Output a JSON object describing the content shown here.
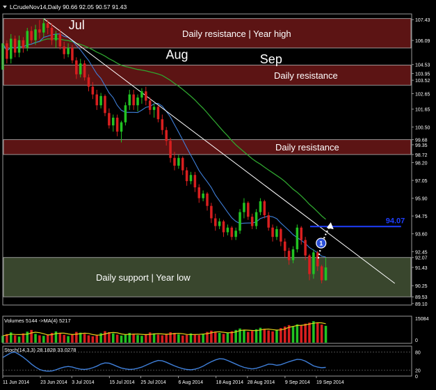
{
  "header": {
    "symbol_line": "LCrudeNov14,Daily  90.66 92.05 90.57 91.43"
  },
  "colors": {
    "background": "#000000",
    "frame": "#9a9a9a",
    "grid": "#2a2a2a",
    "bull": "#22c322",
    "bear": "#d81f1f",
    "ma_fast": "#3f7fd9",
    "ma_slow": "#2fa52f",
    "ma_red": "#e23a3a",
    "trend": "#ffffff",
    "resistance_zone": "#611616",
    "support_zone": "#3d4a30",
    "target_line": "#1f3fff",
    "stoch": "#3f7fd9",
    "volume_ma": "#e3d21a"
  },
  "chart_data": [
    {
      "type": "candlestick",
      "title": "LCrudeNov14,Daily",
      "ohlc_last": {
        "open": 90.66,
        "high": 92.05,
        "low": 90.57,
        "close": 91.43
      },
      "ylim": [
        89.0,
        107.8
      ],
      "x_range_days": [
        0,
        103
      ],
      "y_ticks": [
        107.43,
        106.09,
        104.53,
        103.95,
        103.52,
        102.65,
        101.65,
        100.5,
        99.68,
        99.35,
        98.72,
        98.2,
        97.05,
        95.9,
        94.75,
        93.6,
        92.45,
        92.07,
        91.43,
        90.25,
        89.53,
        89.1
      ],
      "x_ticks": [
        {
          "day": 0,
          "label": "11 Jun 2014"
        },
        {
          "day": 12,
          "label": "23 Jun 2014"
        },
        {
          "day": 22,
          "label": "3 Jul 2014"
        },
        {
          "day": 34,
          "label": "15 Jul 2014"
        },
        {
          "day": 44,
          "label": "25 Jul 2014"
        },
        {
          "day": 56,
          "label": "6 Aug 2014"
        },
        {
          "day": 68,
          "label": "18 Aug 2014"
        },
        {
          "day": 78,
          "label": "28 Aug 2014"
        },
        {
          "day": 90,
          "label": "9 Sep 2014"
        },
        {
          "day": 100,
          "label": "19 Sep 2014"
        }
      ],
      "months": [
        {
          "label": "Jul",
          "day": 21,
          "price": 106.8
        },
        {
          "label": "Aug",
          "day": 52,
          "price": 104.9
        },
        {
          "label": "Sep",
          "day": 82,
          "price": 104.6
        }
      ],
      "zones": [
        {
          "kind": "resistance",
          "label": "Daily resistance | Year high",
          "y_from": 105.6,
          "y_to": 107.5
        },
        {
          "kind": "resistance",
          "label": "Daily resistance",
          "y_from": 103.2,
          "y_to": 104.5
        },
        {
          "kind": "resistance",
          "label": "Daily resistance",
          "y_from": 98.72,
          "y_to": 99.68
        },
        {
          "kind": "support",
          "label": "Daily support | Year low",
          "y_from": 89.53,
          "y_to": 92.07
        }
      ],
      "target": {
        "label": "94.07",
        "value": 94.07,
        "day_from": 98,
        "day_to": 127
      },
      "marker": {
        "label": "1",
        "day": 101.5,
        "price": 93.0
      },
      "trendline": {
        "from": {
          "day": 13,
          "price": 107.5
        },
        "to": {
          "day": 125,
          "price": 90.4
        }
      },
      "candles": [
        [
          104.2,
          106.3,
          103.7,
          105.9
        ],
        [
          105.9,
          106.1,
          104.6,
          104.9
        ],
        [
          104.9,
          106.5,
          104.6,
          106.2
        ],
        [
          106.2,
          106.4,
          105.0,
          105.3
        ],
        [
          105.3,
          106.4,
          105.0,
          106.1
        ],
        [
          106.1,
          106.3,
          105.3,
          105.6
        ],
        [
          105.6,
          106.9,
          105.4,
          106.7
        ],
        [
          106.7,
          107.0,
          105.9,
          106.1
        ],
        [
          106.1,
          107.1,
          105.8,
          106.8
        ],
        [
          106.8,
          107.4,
          106.2,
          106.6
        ],
        [
          106.6,
          107.5,
          106.3,
          107.2
        ],
        [
          107.2,
          107.43,
          106.5,
          106.9
        ],
        [
          106.9,
          107.2,
          105.8,
          106.1
        ],
        [
          106.1,
          106.7,
          105.6,
          106.5
        ],
        [
          106.5,
          106.8,
          105.5,
          105.7
        ],
        [
          105.7,
          106.0,
          104.9,
          105.2
        ],
        [
          105.2,
          105.9,
          105.0,
          105.6
        ],
        [
          105.6,
          105.8,
          104.6,
          104.8
        ],
        [
          104.8,
          105.0,
          103.6,
          103.9
        ],
        [
          103.9,
          104.9,
          103.7,
          104.6
        ],
        [
          104.6,
          104.8,
          103.5,
          103.7
        ],
        [
          103.7,
          103.9,
          102.8,
          103.1
        ],
        [
          103.1,
          103.4,
          102.3,
          102.6
        ],
        [
          102.6,
          102.9,
          101.6,
          101.9
        ],
        [
          101.9,
          102.7,
          101.7,
          102.5
        ],
        [
          102.5,
          102.6,
          101.2,
          101.4
        ],
        [
          101.4,
          101.7,
          100.4,
          100.6
        ],
        [
          100.6,
          101.3,
          100.2,
          101.1
        ],
        [
          101.1,
          101.3,
          99.9,
          100.2
        ],
        [
          100.2,
          100.9,
          99.5,
          100.8
        ],
        [
          100.8,
          102.1,
          100.6,
          101.9
        ],
        [
          101.9,
          102.9,
          101.6,
          102.6
        ],
        [
          102.6,
          102.9,
          101.6,
          101.9
        ],
        [
          101.9,
          102.6,
          101.5,
          102.4
        ],
        [
          102.4,
          103.0,
          102.0,
          102.8
        ],
        [
          102.8,
          103.1,
          101.9,
          102.2
        ],
        [
          102.2,
          102.4,
          101.3,
          101.6
        ],
        [
          101.6,
          102.0,
          101.1,
          101.8
        ],
        [
          101.8,
          101.9,
          100.8,
          101.0
        ],
        [
          101.0,
          101.3,
          100.0,
          100.3
        ],
        [
          100.3,
          100.5,
          99.3,
          99.6
        ],
        [
          99.6,
          99.8,
          98.2,
          98.5
        ],
        [
          98.5,
          98.9,
          97.7,
          98.0
        ],
        [
          98.0,
          98.7,
          97.8,
          98.5
        ],
        [
          98.5,
          98.6,
          97.4,
          97.7
        ],
        [
          97.7,
          97.9,
          96.7,
          97.0
        ],
        [
          97.0,
          97.6,
          96.8,
          97.4
        ],
        [
          97.4,
          97.6,
          96.3,
          96.6
        ],
        [
          96.6,
          96.8,
          95.6,
          95.9
        ],
        [
          95.9,
          96.4,
          95.7,
          96.2
        ],
        [
          96.2,
          96.3,
          95.1,
          95.4
        ],
        [
          95.4,
          95.6,
          94.3,
          94.6
        ],
        [
          94.6,
          94.9,
          93.8,
          94.1
        ],
        [
          94.1,
          94.6,
          93.9,
          94.4
        ],
        [
          94.4,
          94.5,
          93.4,
          93.7
        ],
        [
          93.7,
          94.2,
          93.5,
          94.0
        ],
        [
          94.0,
          94.1,
          93.2,
          93.4
        ],
        [
          93.4,
          94.0,
          93.2,
          93.8
        ],
        [
          93.8,
          95.2,
          93.6,
          95.0
        ],
        [
          95.0,
          95.9,
          94.6,
          95.6
        ],
        [
          95.6,
          95.7,
          94.5,
          94.7
        ],
        [
          94.7,
          94.9,
          93.9,
          94.1
        ],
        [
          94.1,
          95.2,
          93.9,
          95.0
        ],
        [
          95.0,
          95.9,
          94.8,
          95.7
        ],
        [
          95.7,
          95.8,
          94.6,
          94.8
        ],
        [
          94.8,
          95.0,
          93.8,
          94.0
        ],
        [
          94.0,
          94.2,
          93.1,
          93.4
        ],
        [
          93.4,
          94.1,
          93.2,
          93.9
        ],
        [
          93.9,
          94.0,
          92.8,
          93.1
        ],
        [
          93.1,
          93.3,
          92.1,
          92.5
        ],
        [
          92.5,
          92.7,
          91.6,
          91.9
        ],
        [
          91.9,
          92.8,
          91.7,
          92.6
        ],
        [
          92.6,
          94.2,
          92.4,
          94.0
        ],
        [
          94.0,
          94.1,
          92.9,
          93.2
        ],
        [
          93.2,
          93.4,
          91.9,
          92.2
        ],
        [
          92.2,
          92.3,
          90.6,
          91.0
        ],
        [
          91.0,
          92.6,
          90.7,
          92.4
        ],
        [
          92.4,
          92.5,
          91.2,
          91.5
        ],
        [
          91.5,
          91.6,
          90.4,
          90.6
        ],
        [
          90.6,
          92.05,
          90.57,
          91.43
        ]
      ]
    },
    {
      "type": "bar",
      "title": "Volumes 5144 ->MA(4) 5217",
      "y_ticks": [
        15084,
        0
      ],
      "volume_profile": [
        0.28,
        0.35,
        0.42,
        0.3,
        0.25,
        0.38,
        0.45,
        0.52,
        0.36,
        0.3,
        0.28,
        0.33,
        0.4,
        0.46,
        0.38,
        0.32,
        0.27,
        0.35,
        0.44,
        0.41,
        0.36,
        0.3,
        0.26,
        0.31,
        0.39,
        0.47,
        0.43,
        0.38,
        0.33,
        0.29,
        0.34,
        0.4,
        0.37,
        0.31,
        0.28,
        0.35,
        0.42,
        0.38,
        0.33,
        0.3,
        0.36,
        0.43,
        0.4,
        0.34,
        0.29,
        0.32,
        0.38,
        0.35,
        0.31,
        0.37,
        0.44,
        0.49,
        0.45,
        0.4,
        0.36,
        0.41,
        0.47,
        0.52,
        0.58,
        0.5,
        0.44,
        0.48,
        0.55,
        0.61,
        0.57,
        0.5,
        0.46,
        0.53,
        0.6,
        0.66,
        0.72,
        0.68,
        0.75,
        0.7,
        0.78,
        0.82,
        0.88,
        0.8,
        0.74,
        0.69
      ]
    },
    {
      "type": "line",
      "title": "Stoch(14,3,3) 28.1828 33.0278",
      "y_ticks": [
        80,
        20,
        0
      ],
      "stoch_k": [
        62,
        70,
        78,
        80,
        72,
        63,
        52,
        40,
        30,
        22,
        18,
        16,
        17,
        21,
        26,
        30,
        32,
        30,
        26,
        23,
        22,
        24,
        28,
        33,
        40,
        44,
        43,
        38,
        32,
        27,
        24,
        22,
        23,
        26,
        30,
        36,
        42,
        48,
        52,
        51,
        46,
        40,
        34,
        29,
        25,
        22,
        21,
        23,
        27,
        33,
        41,
        48,
        54,
        58,
        57,
        52,
        46,
        40,
        34,
        29,
        26,
        24,
        26,
        30,
        35,
        40,
        39,
        36,
        38,
        43,
        48,
        52,
        56,
        55,
        50,
        42,
        34,
        30,
        28,
        29
      ]
    }
  ]
}
